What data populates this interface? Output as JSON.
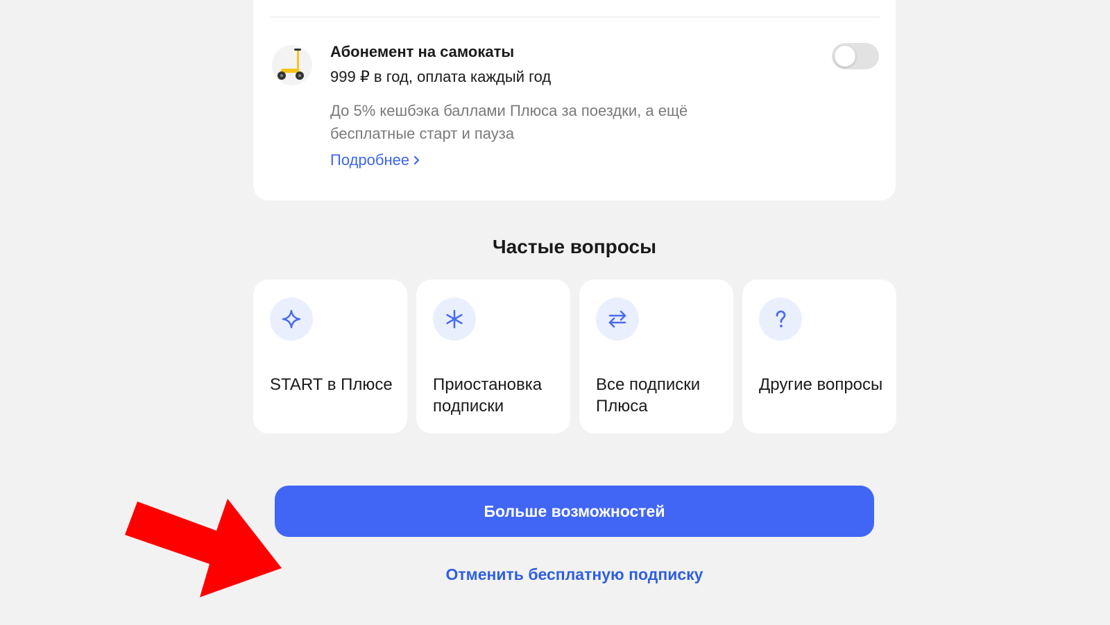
{
  "subscription": {
    "title": "Абонемент на самокаты",
    "price": "999 ₽ в год, оплата каждый год",
    "description": "До 5% кешбэка баллами Плюса за поездки, а ещё бесплатные старт и пауза",
    "more_link": "Подробнее",
    "toggle_on": false
  },
  "faq": {
    "title": "Частые вопросы",
    "items": [
      {
        "label": "START в Плюсе",
        "icon": "sparkle-icon"
      },
      {
        "label": "Приостановка подписки",
        "icon": "asterisk-icon"
      },
      {
        "label": "Все подписки Плюса",
        "icon": "swap-arrows-icon"
      },
      {
        "label": "Другие вопросы",
        "icon": "question-icon"
      }
    ]
  },
  "actions": {
    "primary_label": "Больше возможностей",
    "cancel_label": "Отменить бесплатную подписку"
  },
  "colors": {
    "accent": "#4166f5",
    "link": "#2f5fe0",
    "annotation_arrow": "#ff0000",
    "icon_bg": "#eaeffe"
  }
}
